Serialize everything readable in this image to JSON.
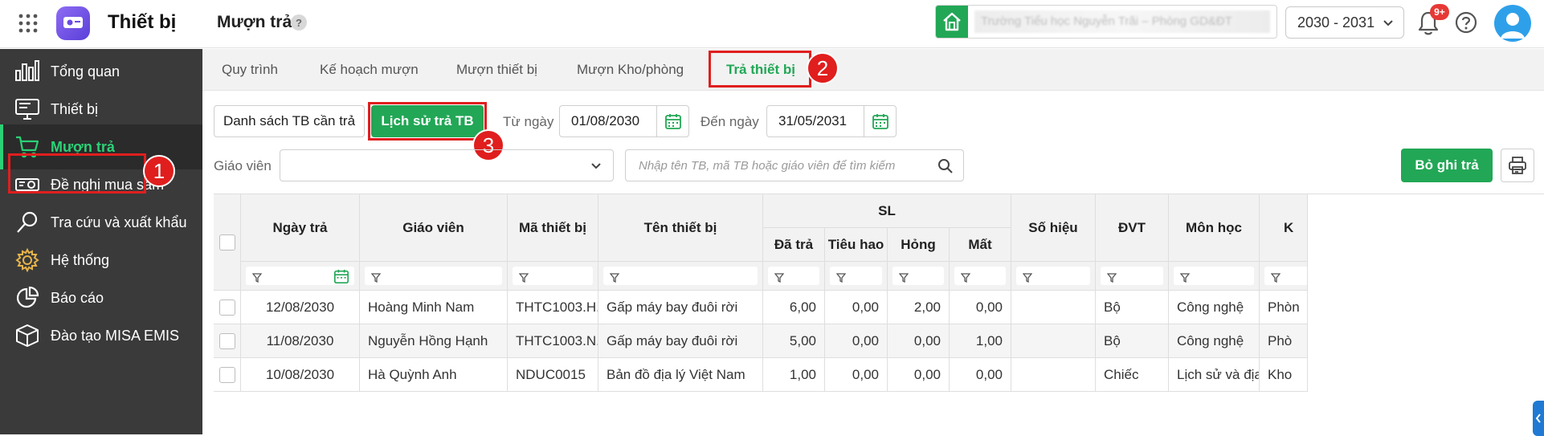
{
  "topbar": {
    "app_title": "Thiết bị",
    "page_title": "Mượn trả",
    "help_mark": "?",
    "school_name": "Trường Tiểu học Nguyễn Trãi – Phòng GD&ĐT",
    "year": "2030 - 2031",
    "notification_badge": "9+"
  },
  "sidebar": {
    "items": [
      {
        "label": "Tổng quan",
        "icon": "dashboard-icon"
      },
      {
        "label": "Thiết bị",
        "icon": "monitor-icon"
      },
      {
        "label": "Mượn trả",
        "icon": "cart-icon"
      },
      {
        "label": "Đề nghị mua sắm",
        "icon": "projector-icon"
      },
      {
        "label": "Tra cứu và xuất khẩu",
        "icon": "search-icon"
      },
      {
        "label": "Hệ thống",
        "icon": "gear-icon"
      },
      {
        "label": "Báo cáo",
        "icon": "pie-chart-icon"
      },
      {
        "label": "Đào tạo MISA EMIS",
        "icon": "cube-icon"
      }
    ],
    "active_index": 2
  },
  "tabs": [
    "Quy trình",
    "Kế hoạch mượn",
    "Mượn thiết bị",
    "Mượn Kho/phòng",
    "Trả thiết bị"
  ],
  "subtabs": [
    "Danh sách TB cần trả",
    "Lịch sử trả TB"
  ],
  "filters": {
    "from_label": "Từ ngày",
    "from_date": "01/08/2030",
    "to_label": "Đến ngày",
    "to_date": "31/05/2031",
    "teacher_label": "Giáo viên",
    "search_placeholder": "Nhập tên TB, mã TB hoặc giáo viên để tìm kiếm",
    "action_button": "Bỏ ghi trả"
  },
  "annotations": [
    "1",
    "2",
    "3"
  ],
  "table": {
    "headers": {
      "date": "Ngày trả",
      "teacher": "Giáo viên",
      "code": "Mã thiết bị",
      "name": "Tên thiết bị",
      "sl": "SL",
      "returned": "Đã trả",
      "consumed": "Tiêu hao",
      "broken": "Hỏng",
      "lost": "Mất",
      "serial": "Số hiệu",
      "unit": "ĐVT",
      "subject": "Môn học",
      "next": "K"
    },
    "rows": [
      {
        "date": "12/08/2030",
        "teacher": "Hoàng Minh Nam",
        "code": "THTC1003.H...",
        "name": "Gấp máy bay đuôi rời",
        "returned": "6,00",
        "consumed": "0,00",
        "broken": "2,00",
        "lost": "0,00",
        "serial": "",
        "unit": "Bộ",
        "subject": "Công nghệ",
        "next": "Phòn"
      },
      {
        "date": "11/08/2030",
        "teacher": "Nguyễn Hồng Hạnh",
        "code": "THTC1003.N...",
        "name": "Gấp máy bay đuôi rời",
        "returned": "5,00",
        "consumed": "0,00",
        "broken": "0,00",
        "lost": "1,00",
        "serial": "",
        "unit": "Bộ",
        "subject": "Công nghệ",
        "next": "Phò"
      },
      {
        "date": "10/08/2030",
        "teacher": "Hà Quỳnh Anh",
        "code": "NDUC0015",
        "name": "Bản đồ địa lý Việt Nam",
        "returned": "1,00",
        "consumed": "0,00",
        "broken": "0,00",
        "lost": "0,00",
        "serial": "",
        "unit": "Chiếc",
        "subject": "Lịch sử và địa lí",
        "next": "Kho"
      }
    ]
  },
  "colors": {
    "brand_green": "#22a756",
    "sidebar_bg": "#3a3a3a",
    "highlight_red": "#e01e1e",
    "active_text": "#2bd176"
  }
}
